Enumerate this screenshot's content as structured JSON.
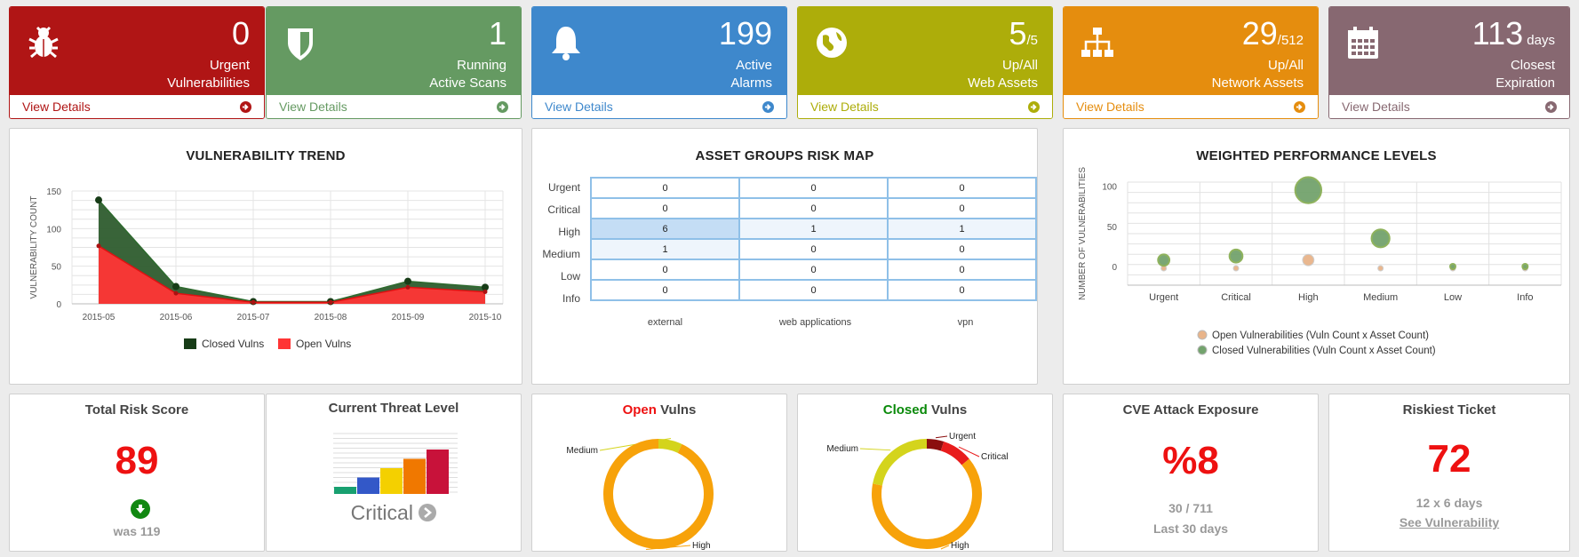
{
  "stats": [
    {
      "value": "0",
      "suffix": "",
      "label1": "Urgent",
      "label2": "Vulnerabilities",
      "link": "View Details",
      "color": "#b01515",
      "icon": "bug-icon"
    },
    {
      "value": "1",
      "suffix": "",
      "label1": "Running",
      "label2": "Active Scans",
      "link": "View Details",
      "color": "#659a62",
      "icon": "shield-icon"
    },
    {
      "value": "199",
      "suffix": "",
      "label1": "Active",
      "label2": "Alarms",
      "link": "View Details",
      "color": "#3e88cc",
      "icon": "bell-icon"
    },
    {
      "value": "5",
      "suffix": "/5",
      "label1": "Up/All",
      "label2": "Web Assets",
      "link": "View Details",
      "color": "#adad0a",
      "icon": "globe-icon"
    },
    {
      "value": "29",
      "suffix": "/512",
      "label1": "Up/All",
      "label2": "Network Assets",
      "link": "View Details",
      "color": "#e58d0e",
      "icon": "sitemap-icon"
    },
    {
      "value": "113",
      "suffix": " days",
      "label1": "Closest",
      "label2": "Expiration",
      "link": "View Details",
      "color": "#876871",
      "icon": "calendar-icon"
    }
  ],
  "trend": {
    "title": "VULNERABILITY TREND",
    "chart_data": {
      "type": "area",
      "categories": [
        "2015-05",
        "2015-06",
        "2015-07",
        "2015-08",
        "2015-09",
        "2015-10"
      ],
      "series": [
        {
          "name": "Closed Vulns",
          "color": "#2e5c2e",
          "values": [
            138,
            23,
            3,
            3,
            30,
            22
          ]
        },
        {
          "name": "Open Vulns",
          "color": "#ff3535",
          "values": [
            77,
            14,
            2,
            2,
            22,
            16
          ]
        }
      ],
      "ylabel": "VULNERABILITY COUNT",
      "yticks": [
        0,
        50,
        100,
        150
      ],
      "ylim": [
        0,
        150
      ],
      "legend": "bottom"
    }
  },
  "riskmap": {
    "title": "ASSET GROUPS RISK MAP",
    "rows": [
      "Urgent",
      "Critical",
      "High",
      "Medium",
      "Low",
      "Info"
    ],
    "cols": [
      "external",
      "web applications",
      "vpn"
    ],
    "cells": [
      [
        "0",
        "0",
        "0"
      ],
      [
        "0",
        "0",
        "0"
      ],
      [
        "6",
        "1",
        "1"
      ],
      [
        "1",
        "0",
        "0"
      ],
      [
        "0",
        "0",
        "0"
      ],
      [
        "0",
        "0",
        "0"
      ]
    ]
  },
  "weighted": {
    "title": "WEIGHTED PERFORMANCE LEVELS",
    "chart_data": {
      "type": "scatter",
      "categories": [
        "Urgent",
        "Critical",
        "High",
        "Medium",
        "Low",
        "Info"
      ],
      "ylabel": "NUMBER OF VULNERABILITIES",
      "yticks": [
        0,
        50,
        100
      ],
      "series": [
        {
          "name": "Open Vulnerabilities (Vuln Count x Asset Count)",
          "color": "#e8b48a",
          "values": [
            0,
            0,
            8,
            0,
            0,
            0
          ]
        },
        {
          "name": "Closed Vulnerabilities (Vuln Count x Asset Count)",
          "color": "#73a36d",
          "values": [
            8,
            13,
            95,
            35,
            0,
            0
          ]
        }
      ],
      "legend": "bottom"
    }
  },
  "risk_score": {
    "title": "Total Risk Score",
    "value": "89",
    "was": "was 119"
  },
  "threat": {
    "title": "Current Threat Level",
    "level": "Critical",
    "chart_data": {
      "type": "bar",
      "values": [
        1,
        2,
        3,
        4,
        5
      ],
      "colors": [
        "#18a070",
        "#3358c8",
        "#f4d000",
        "#f07800",
        "#c8123a"
      ]
    }
  },
  "open_vulns": {
    "title_colored": "Open",
    "title_rest": " Vulns",
    "title_color": "#ee1111",
    "chart_data": {
      "type": "pie",
      "slices": [
        {
          "label": "Medium",
          "value": 7,
          "color": "#d4d41c"
        },
        {
          "label": "High",
          "value": 93,
          "color": "#f7a20a"
        }
      ]
    }
  },
  "closed_vulns": {
    "title_colored": "Closed",
    "title_rest": " Vulns",
    "title_color": "#0a8a0a",
    "chart_data": {
      "type": "pie",
      "slices": [
        {
          "label": "Urgent",
          "value": 5,
          "color": "#8b0e0e"
        },
        {
          "label": "Critical",
          "value": 9,
          "color": "#e81c1c"
        },
        {
          "label": "High",
          "value": 64,
          "color": "#f7a20a"
        },
        {
          "label": "Medium",
          "value": 22,
          "color": "#d4d41c"
        }
      ]
    }
  },
  "cve": {
    "title": "CVE Attack Exposure",
    "value": "%8",
    "ratio": "30 / 711",
    "period": "Last 30 days"
  },
  "ticket": {
    "title": "Riskiest Ticket",
    "value": "72",
    "dims": "12 x 6 days",
    "link": "See Vulnerability"
  }
}
